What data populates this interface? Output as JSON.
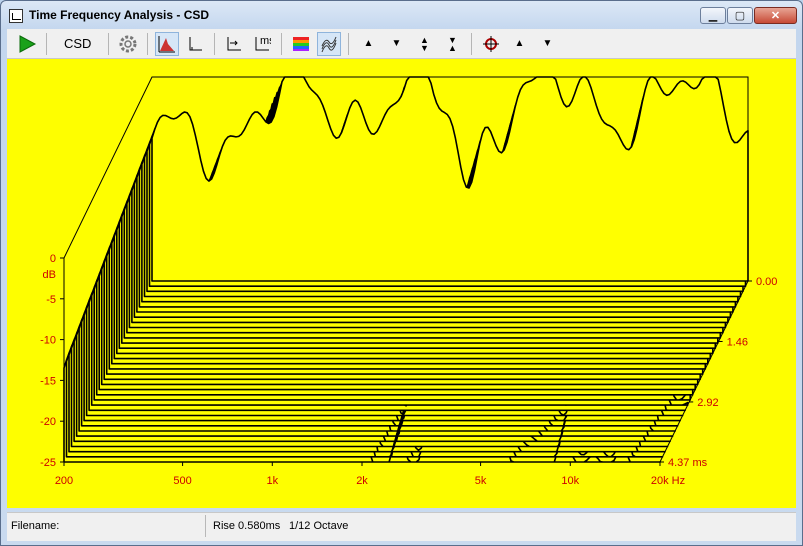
{
  "window": {
    "title": "Time Frequency Analysis - CSD"
  },
  "toolbar": {
    "play_icon": "play-icon",
    "csd_label": "CSD",
    "icons": [
      "gear-icon",
      "waterfall-view-icon",
      "axis-view-icon",
      "axis-scale-icon",
      "time-scale-icon",
      "color-map-icon",
      "surface-icon",
      "up-arrow-icon",
      "down-arrow-icon",
      "expand-icon",
      "compress-icon",
      "crosshair-icon",
      "up-arrow-icon",
      "down-arrow-icon"
    ]
  },
  "plot": {
    "background": "#ffff00",
    "label_color": "#cc0000",
    "y_ticks": [
      "0",
      "-5",
      "-10",
      "-15",
      "-20",
      "-25"
    ],
    "y_unit": "dB",
    "x_ticks": [
      "200",
      "500",
      "1k",
      "2k",
      "5k",
      "10k",
      "20k Hz"
    ],
    "t_ticks": [
      "0.00",
      "1.46",
      "2.92",
      "4.37 ms"
    ]
  },
  "chart_data": {
    "type": "area",
    "title": "",
    "xlabel": "Hz",
    "ylabel": "dB",
    "zlabel": "ms",
    "x_scale": "log",
    "xlim": [
      200,
      20000
    ],
    "ylim": [
      -25,
      0
    ],
    "tlim": [
      0.0,
      4.37
    ],
    "x_ticks": [
      200,
      500,
      1000,
      2000,
      5000,
      10000,
      20000
    ],
    "y_ticks": [
      0,
      -5,
      -10,
      -15,
      -20,
      -25
    ],
    "t_ticks": [
      0.0,
      1.46,
      2.92,
      4.37
    ]
  },
  "status": {
    "filename_label": "Filename:",
    "rise": "Rise 0.580ms",
    "octave": "1/12 Octave"
  }
}
